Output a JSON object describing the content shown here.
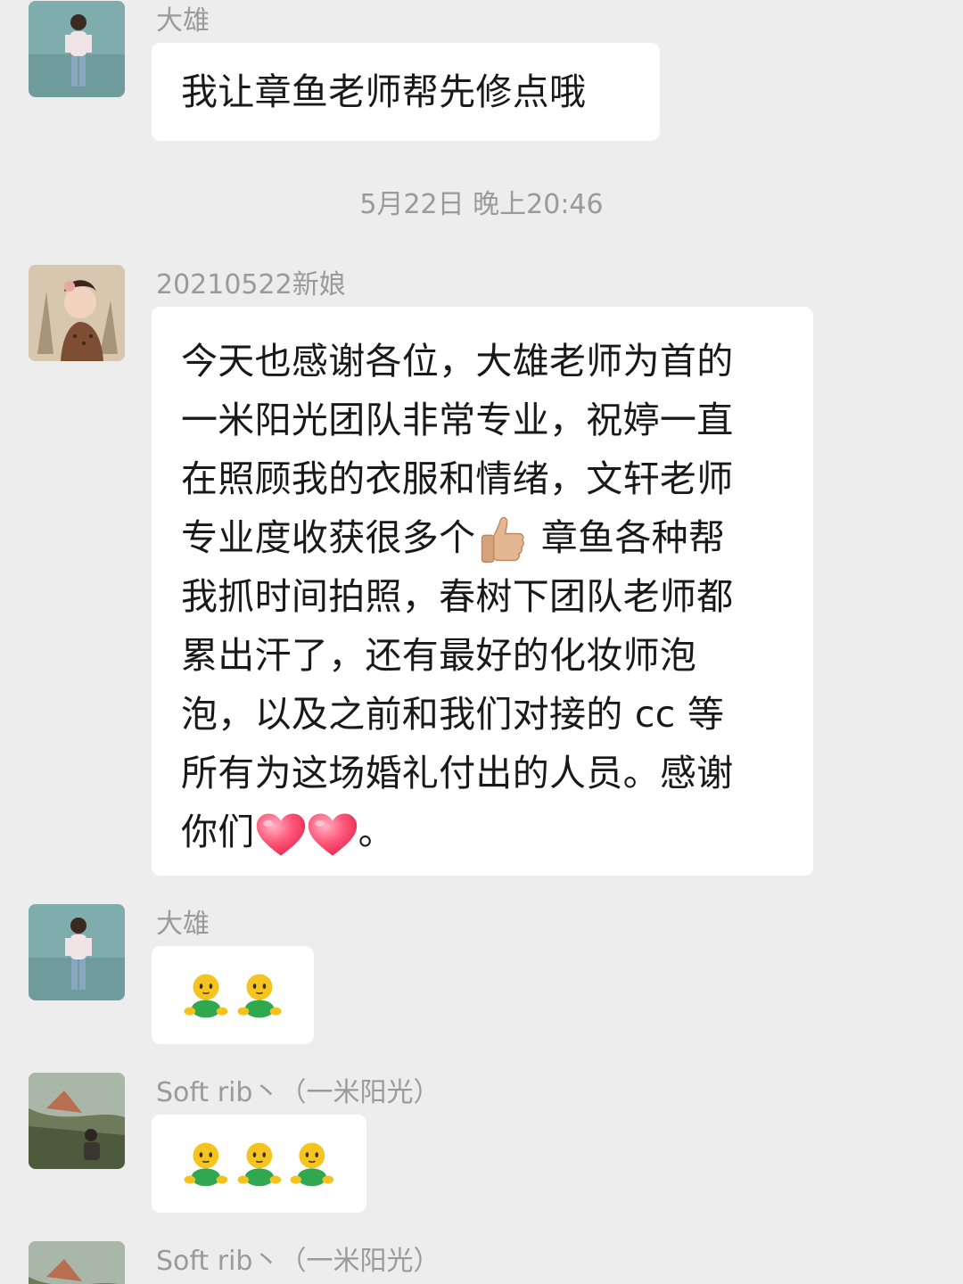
{
  "messages": [
    {
      "sender": "大雄",
      "text": "我让章鱼老师帮先修点哦"
    },
    {
      "timestamp": "5月22日 晚上20:46"
    },
    {
      "sender": "20210522新娘",
      "lines": [
        "今天也感谢各位，大雄老师为首的",
        "一米阳光团队非常专业，祝婷一直",
        "在照顾我的衣服和情绪，文轩老师",
        "专业度收获很多个",
        " 章鱼各种帮",
        "我抓时间拍照，春树下团队老师都",
        "累出汗了，还有最好的化妆师泡",
        "泡，以及之前和我们对接的 cc 等",
        "所有为这场婚礼付出的人员。感谢",
        "你们",
        "。"
      ],
      "emojis": [
        "thumbs-up-icon",
        "red-heart-icon",
        "red-heart-icon"
      ]
    },
    {
      "sender": "大雄",
      "emojis": [
        "green-person-icon",
        "green-person-icon"
      ]
    },
    {
      "sender": "Soft rib丶（一米阳光）",
      "emojis": [
        "green-person-icon",
        "green-person-icon",
        "green-person-icon"
      ]
    },
    {
      "sender": "Soft rib丶（一米阳光）"
    }
  ],
  "colors": {
    "background": "#ededed",
    "bubble": "#ffffff",
    "meta_text": "#9a9a9a",
    "body_text": "#191919"
  }
}
